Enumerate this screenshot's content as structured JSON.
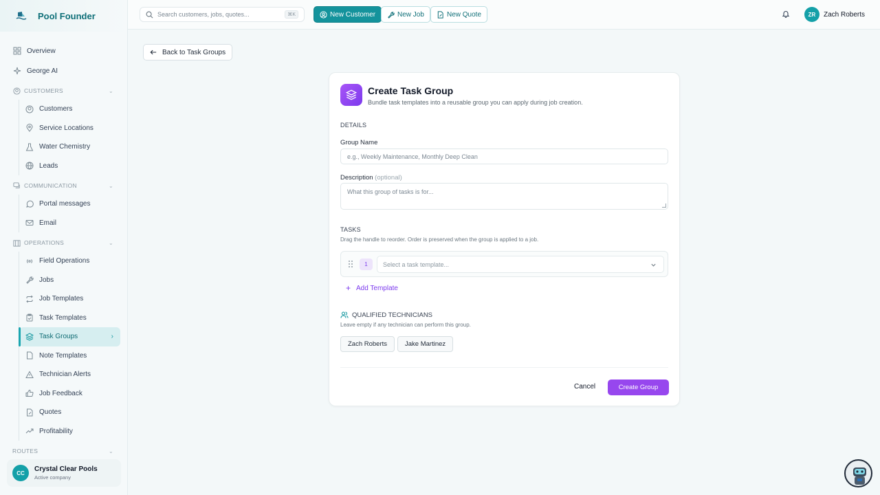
{
  "brand": {
    "name": "Pool Founder"
  },
  "sidebar": {
    "top_items": [
      {
        "label": "Overview",
        "icon": "grid-icon"
      },
      {
        "label": "George AI",
        "icon": "sparkle-icon"
      }
    ],
    "sections": {
      "customers": {
        "label": "CUSTOMERS",
        "items": [
          "Customers",
          "Service Locations",
          "Water Chemistry",
          "Leads"
        ]
      },
      "communication": {
        "label": "COMMUNICATION",
        "items": [
          "Portal messages",
          "Email"
        ]
      },
      "operations": {
        "label": "OPERATIONS",
        "items": [
          "Field Operations",
          "Jobs",
          "Job Templates",
          "Task Templates",
          "Task Groups",
          "Note Templates",
          "Technician Alerts",
          "Job Feedback",
          "Quotes",
          "Profitability"
        ]
      },
      "routes": {
        "label": "ROUTES"
      }
    },
    "active_item": "Task Groups",
    "company": {
      "initials": "CC",
      "name": "Crystal Clear Pools",
      "status": "Active company"
    }
  },
  "topbar": {
    "search_placeholder": "Search customers, jobs, quotes...",
    "search_shortcut": "⌘K",
    "new_customer": "New Customer",
    "new_job": "New Job",
    "new_quote": "New Quote",
    "user": {
      "initials": "ZR",
      "name": "Zach Roberts"
    }
  },
  "back_label": "Back to Task Groups",
  "form": {
    "title": "Create Task Group",
    "subtitle": "Bundle task templates into a reusable group you can apply during job creation.",
    "details_label": "DETAILS",
    "group_name_label": "Group Name",
    "group_name_placeholder": "e.g., Weekly Maintenance, Monthly Deep Clean",
    "description_label": "Description",
    "description_optional": "(optional)",
    "description_placeholder": "What this group of tasks is for...",
    "tasks_label": "TASKS",
    "tasks_hint": "Drag the handle to reorder. Order is preserved when the group is applied to a job.",
    "task_rows": [
      {
        "number": "1",
        "placeholder": "Select a task template..."
      }
    ],
    "add_template": "Add Template",
    "qualified_label": "QUALIFIED TECHNICIANS",
    "qualified_hint": "Leave empty if any technician can perform this group.",
    "technicians": [
      "Zach Roberts",
      "Jake Martinez"
    ],
    "cancel": "Cancel",
    "create": "Create Group"
  },
  "colors": {
    "accent": "#14939c",
    "purple": "#9747ee"
  }
}
